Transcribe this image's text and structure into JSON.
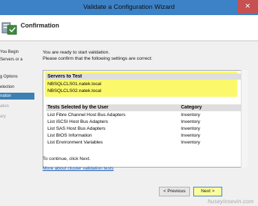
{
  "window": {
    "title": "Validate a Configuration Wizard",
    "close_glyph": "✕"
  },
  "header": {
    "heading": "Confirmation"
  },
  "steps": [
    {
      "label": "You Begin"
    },
    {
      "label": "Servers or a"
    },
    {
      "label": "g Options"
    },
    {
      "label": "election"
    },
    {
      "label": "nation"
    },
    {
      "label": "ation"
    },
    {
      "label": "ary"
    }
  ],
  "content": {
    "intro_line1": "You are ready to start validation.",
    "intro_line2": "Please confirm that the following settings are correct:",
    "servers_heading": "Servers to Test",
    "servers": [
      "NBSQLCLS01.natek.local",
      "NBSQLCLS02.natek.local"
    ],
    "tests_col1": "Tests Selected by the User",
    "tests_col2": "Category",
    "tests": [
      {
        "name": "List Fibre Channel Host Bus Adapters",
        "category": "Inventory"
      },
      {
        "name": "List iSCSI Host Bus Adapters",
        "category": "Inventory"
      },
      {
        "name": "List SAS Host Bus Adapters",
        "category": "Inventory"
      },
      {
        "name": "List BIOS Information",
        "category": "Inventory"
      },
      {
        "name": "List Environment Variables",
        "category": "Inventory"
      }
    ],
    "proceed_text": "To continue, click Next.",
    "link_text": "More about cluster validation tests"
  },
  "buttons": {
    "previous": "< Previous",
    "next": "Next >"
  },
  "watermark": "huseyinsevin.com",
  "colors": {
    "titlebar": "#3d82c7",
    "highlight": "#fbf96b",
    "active_step": "#3c7fb1",
    "close": "#c75050"
  }
}
